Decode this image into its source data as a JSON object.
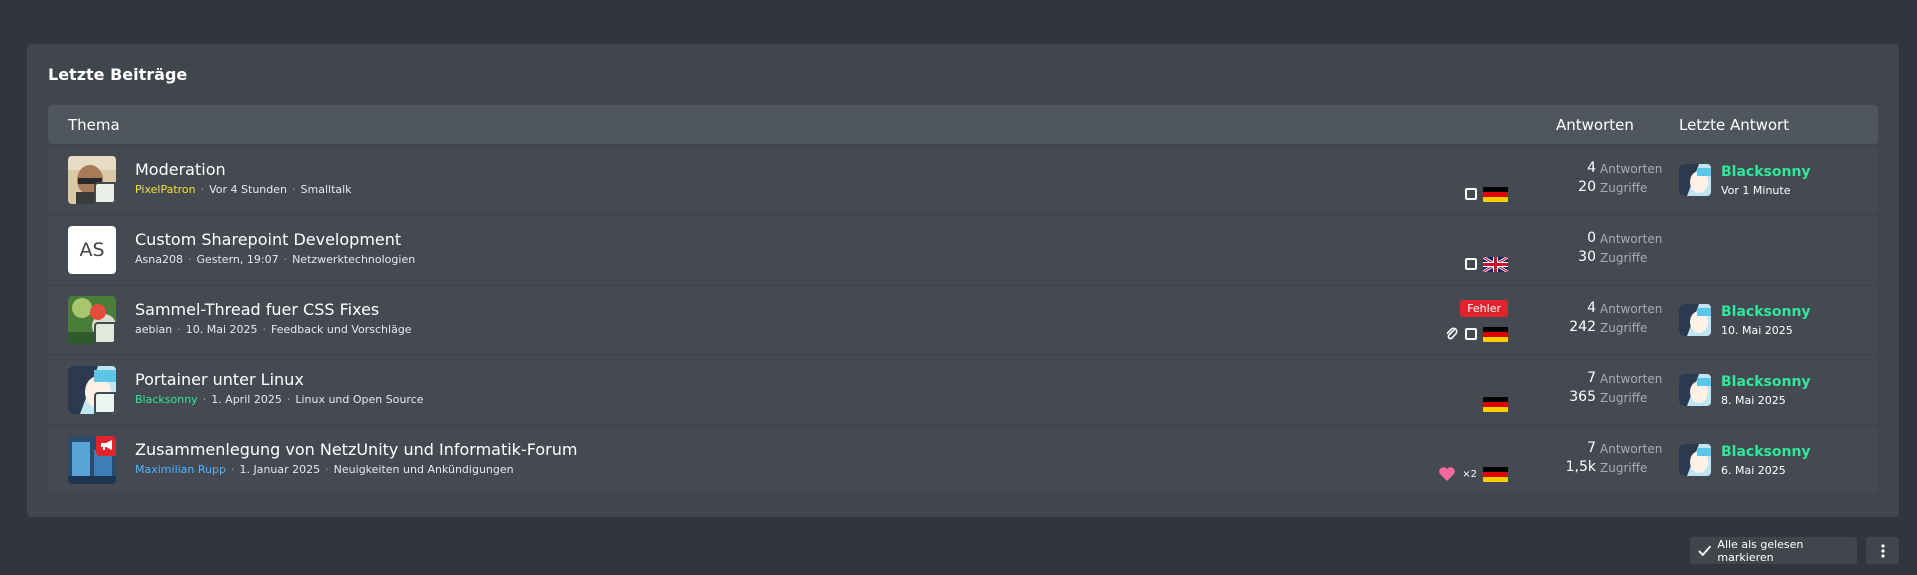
{
  "box": {
    "title": "Letzte Beiträge"
  },
  "header": {
    "topic": "Thema",
    "answers": "Antworten",
    "last": "Letzte Antwort"
  },
  "rows": [
    {
      "title": "Moderation",
      "author": "PixelPatron",
      "date": "Vor 4 Stunden",
      "forum": "Smalltalk",
      "answers_num": "4",
      "answers_label": "Antworten",
      "views_num": "20",
      "views_label": "Zugriffe",
      "last_user": "Blacksonny",
      "last_time": "Vor 1 Minute",
      "flag": "de"
    },
    {
      "title": "Custom Sharepoint Development",
      "author": "Asna208",
      "initials": "AS",
      "date": "Gestern, 19:07",
      "forum": "Netzwerktechnologien",
      "answers_num": "0",
      "answers_label": "Antworten",
      "views_num": "30",
      "views_label": "Zugriffe",
      "flag": "gb"
    },
    {
      "title": "Sammel-Thread fuer CSS Fixes",
      "author": "aebian",
      "date": "10. Mai 2025",
      "forum": "Feedback und Vorschläge",
      "label": "Fehler",
      "answers_num": "4",
      "answers_label": "Antworten",
      "views_num": "242",
      "views_label": "Zugriffe",
      "last_user": "Blacksonny",
      "last_time": "10. Mai 2025",
      "flag": "de"
    },
    {
      "title": "Portainer unter Linux",
      "author": "Blacksonny",
      "date": "1. April 2025",
      "forum": "Linux und Open Source",
      "answers_num": "7",
      "answers_label": "Antworten",
      "views_num": "365",
      "views_label": "Zugriffe",
      "last_user": "Blacksonny",
      "last_time": "8. Mai 2025",
      "flag": "de"
    },
    {
      "title": "Zusammenlegung von NetzUnity und Informatik-Forum",
      "author": "Maximilian Rupp",
      "date": "1. Januar 2025",
      "forum": "Neuigkeiten und Ankündigungen",
      "reactions": "×2",
      "answers_num": "7",
      "answers_label": "Antworten",
      "views_num": "1,5k",
      "views_label": "Zugriffe",
      "last_user": "Blacksonny",
      "last_time": "6. Mai 2025",
      "flag": "de"
    }
  ],
  "footer": {
    "mark_read": "Alle als gelesen markieren"
  },
  "icons": {
    "check": "check-icon",
    "menu": "vertical-dots-icon",
    "paperclip": "paperclip-icon",
    "heart": "heart-icon",
    "megaphone": "megaphone-icon"
  },
  "colors": {
    "accent_green": "#2ee89b",
    "yellow_user": "#f1e23b",
    "blue_user": "#4fb3ff",
    "label_red": "#e0242c"
  }
}
